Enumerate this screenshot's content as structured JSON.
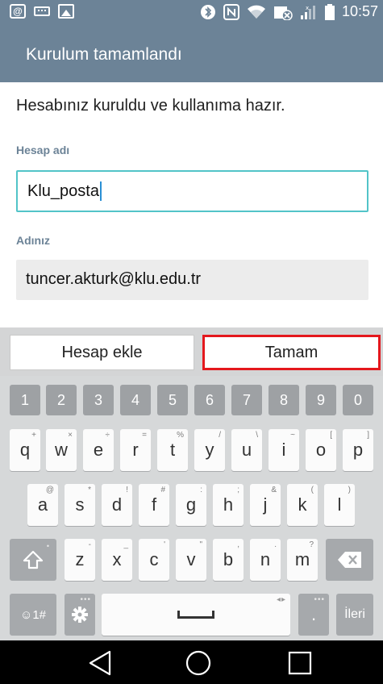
{
  "status_bar": {
    "time": "10:57",
    "left_icons": [
      "at-sign-icon",
      "keyboard-icon",
      "image-icon"
    ],
    "right_icons": [
      "bluetooth-icon",
      "nfc-icon",
      "wifi-icon",
      "data-saver-icon",
      "signal-icon",
      "battery-icon"
    ]
  },
  "header": {
    "title": "Kurulum tamamlandı"
  },
  "content": {
    "message": "Hesabınız kuruldu ve kullanıma hazır.",
    "account_name_label": "Hesap adı",
    "account_name_value": "Klu_posta",
    "your_name_label": "Adınız",
    "your_name_value": "tuncer.akturk@klu.edu.tr"
  },
  "buttons": {
    "add_account": "Hesap ekle",
    "ok": "Tamam"
  },
  "keyboard": {
    "numbers": [
      "1",
      "2",
      "3",
      "4",
      "5",
      "6",
      "7",
      "8",
      "9",
      "0"
    ],
    "row1": [
      {
        "key": "q",
        "hint": "+"
      },
      {
        "key": "w",
        "hint": "×"
      },
      {
        "key": "e",
        "hint": "÷"
      },
      {
        "key": "r",
        "hint": "="
      },
      {
        "key": "t",
        "hint": "%"
      },
      {
        "key": "y",
        "hint": "/"
      },
      {
        "key": "u",
        "hint": "\\"
      },
      {
        "key": "i",
        "hint": "~"
      },
      {
        "key": "o",
        "hint": "["
      },
      {
        "key": "p",
        "hint": "]"
      }
    ],
    "row2": [
      {
        "key": "a",
        "hint": "@"
      },
      {
        "key": "s",
        "hint": "*"
      },
      {
        "key": "d",
        "hint": "!"
      },
      {
        "key": "f",
        "hint": "#"
      },
      {
        "key": "g",
        "hint": ":"
      },
      {
        "key": "h",
        "hint": ";"
      },
      {
        "key": "j",
        "hint": "&"
      },
      {
        "key": "k",
        "hint": "("
      },
      {
        "key": "l",
        "hint": ")"
      }
    ],
    "row3": [
      {
        "key": "z",
        "hint": "-"
      },
      {
        "key": "x",
        "hint": "_"
      },
      {
        "key": "c",
        "hint": "'"
      },
      {
        "key": "v",
        "hint": "\""
      },
      {
        "key": "b",
        "hint": ","
      },
      {
        "key": "n",
        "hint": "."
      },
      {
        "key": "m",
        "hint": "?"
      }
    ],
    "symbols_key": "☺1#",
    "period_key": ".",
    "next_key": "İleri",
    "space_hint": "◂▸"
  },
  "colors": {
    "header_bg": "#6c8397",
    "field_focus": "#52c4c8",
    "highlight_border": "#e4181d"
  }
}
